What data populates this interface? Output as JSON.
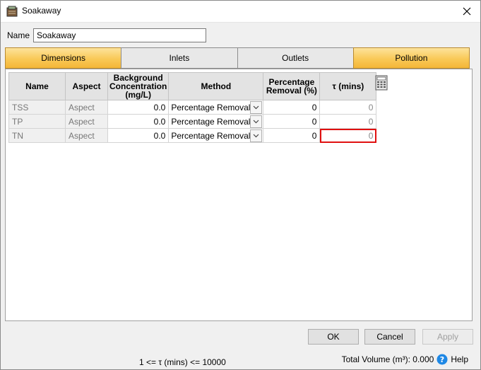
{
  "window": {
    "title": "Soakaway"
  },
  "name_field": {
    "label": "Name",
    "value": "Soakaway"
  },
  "tabs": [
    {
      "label": "Dimensions",
      "active": true
    },
    {
      "label": "Inlets",
      "active": false
    },
    {
      "label": "Outlets",
      "active": false
    },
    {
      "label": "Pollution",
      "active": true
    }
  ],
  "grid": {
    "headers": [
      "Name",
      "Aspect",
      "Background Concentration (mg/L)",
      "Method",
      "Percentage Removal (%)",
      "τ (mins)"
    ],
    "rows": [
      {
        "name": "TSS",
        "aspect": "Aspect",
        "background": "0.0",
        "method": "Percentage Removal",
        "removal": "0",
        "tau": "0"
      },
      {
        "name": "TP",
        "aspect": "Aspect",
        "background": "0.0",
        "method": "Percentage Removal",
        "removal": "0",
        "tau": "0"
      },
      {
        "name": "TN",
        "aspect": "Aspect",
        "background": "0.0",
        "method": "Percentage Removal",
        "removal": "0",
        "tau": "0"
      }
    ]
  },
  "buttons": {
    "ok": "OK",
    "cancel": "Cancel",
    "apply": "Apply"
  },
  "status": {
    "range": "1 <= τ (mins) <= 10000",
    "total_volume": "Total Volume (m³): 0.000",
    "help": "Help"
  },
  "colors": {
    "tab_accent": "#f9c957",
    "selection_border": "#e01010",
    "help_blue": "#1e88e5"
  },
  "icons": [
    "app-icon",
    "close-icon",
    "dropdown-chevron-icon",
    "calculator-icon",
    "help-icon"
  ]
}
